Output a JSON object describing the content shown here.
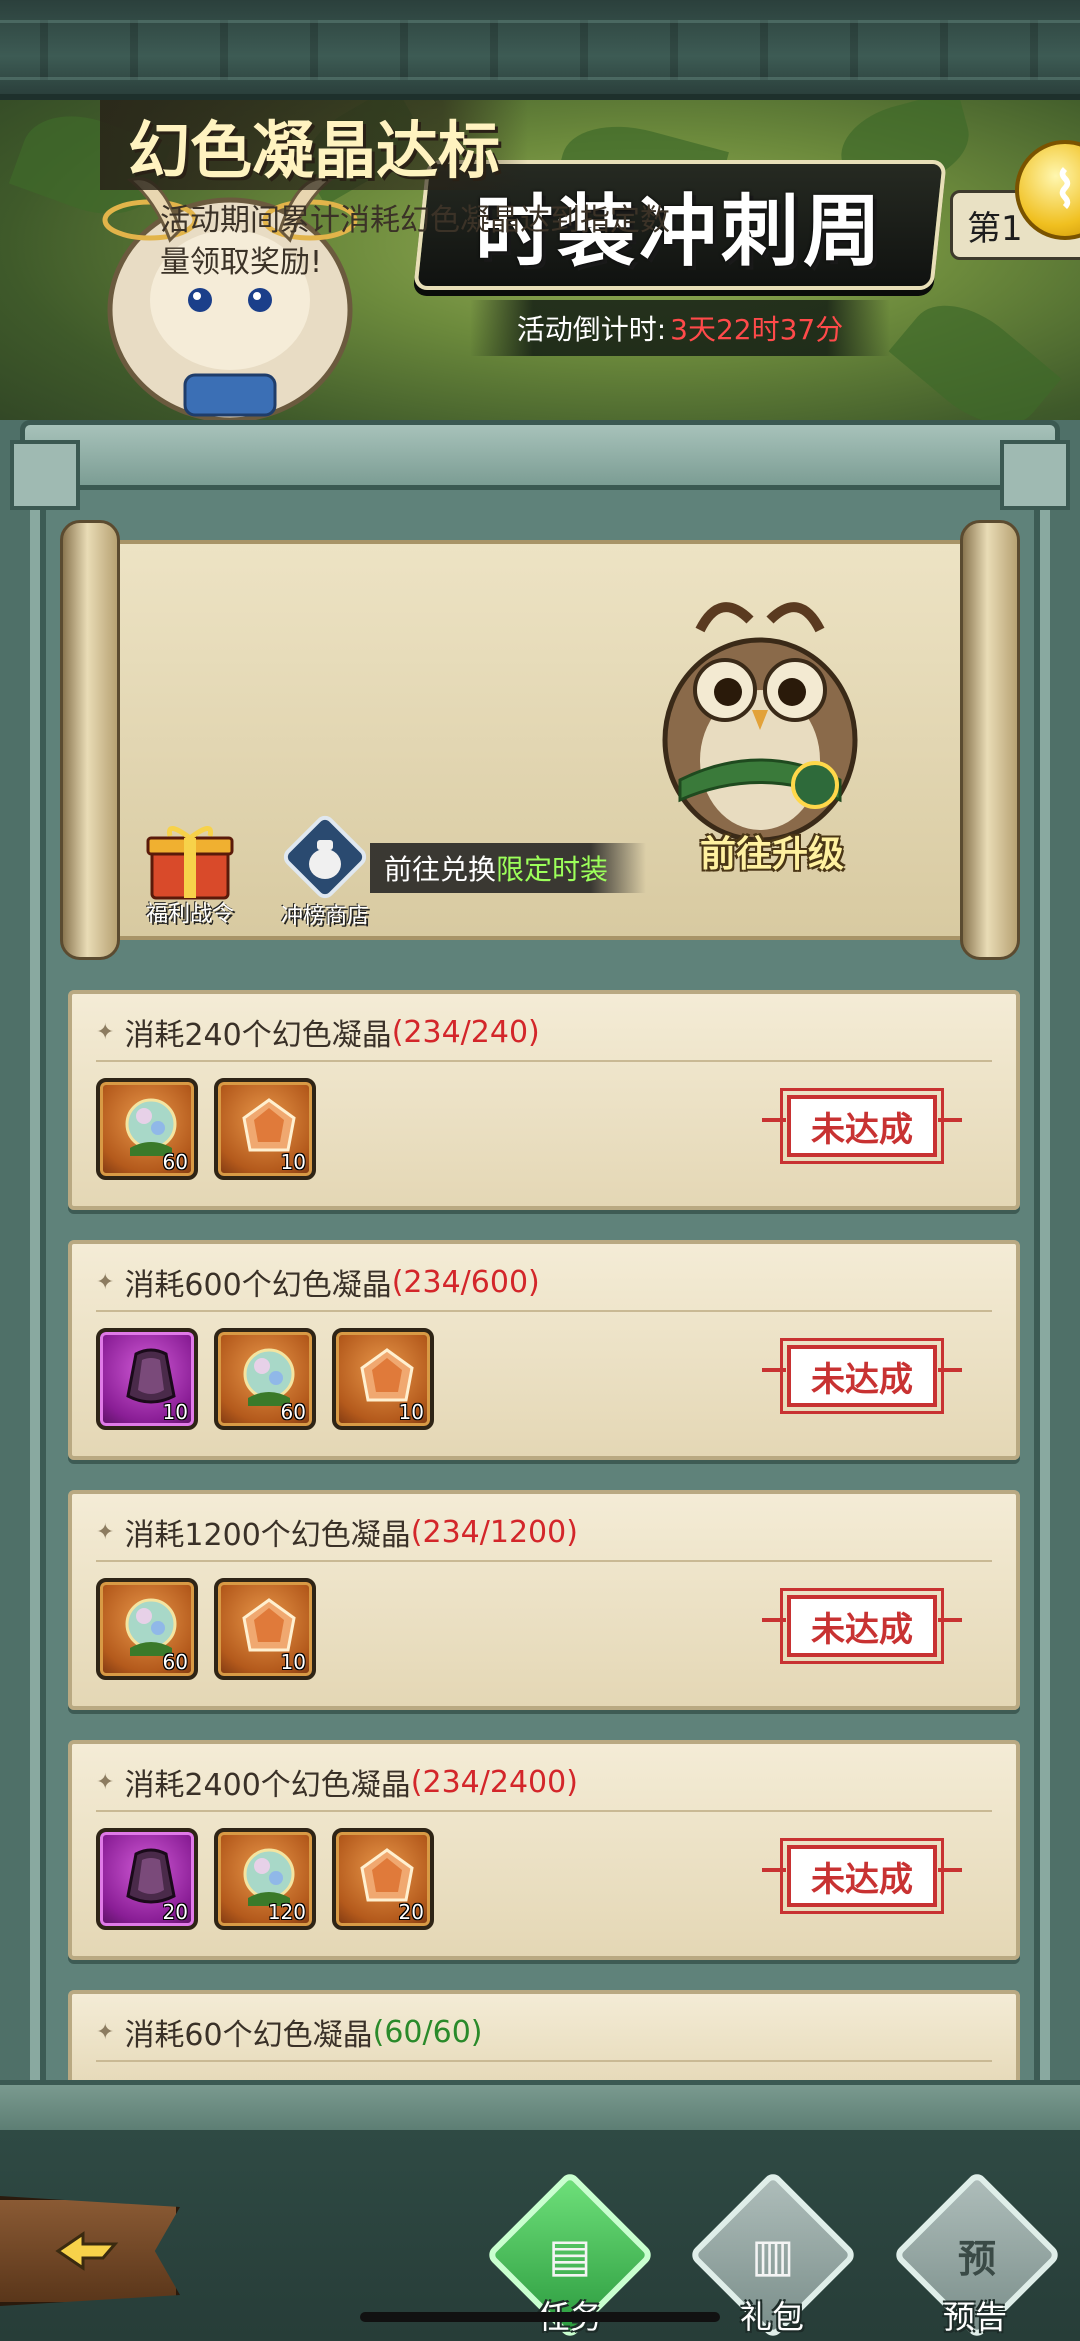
{
  "header": {
    "title": "时装冲刺周",
    "week_tab": "第1",
    "countdown_label": "活动倒计时:",
    "countdown_value": "3天22时37分"
  },
  "event": {
    "title": "幻色凝晶达标",
    "description": "活动期间累计消耗幻色凝晶达到指定数量领取奖励!",
    "upgrade_label": "前往升级",
    "gift_label": "福利战令",
    "shop_label": "冲榜商店",
    "exchange_prefix": "前往兑换",
    "exchange_highlight": "限定时装"
  },
  "tasks": [
    {
      "title": "消耗240个幻色凝晶",
      "progress": "(234/240)",
      "progress_color": "red",
      "rewards": [
        {
          "type": "crystal-orb",
          "frame": "orange",
          "count": "60"
        },
        {
          "type": "amber-gem",
          "frame": "orange",
          "count": "10"
        }
      ],
      "status": "未达成"
    },
    {
      "title": "消耗600个幻色凝晶",
      "progress": "(234/600)",
      "progress_color": "red",
      "rewards": [
        {
          "type": "purple-cloak",
          "frame": "purple",
          "count": "10"
        },
        {
          "type": "crystal-orb",
          "frame": "orange",
          "count": "60"
        },
        {
          "type": "amber-gem",
          "frame": "orange",
          "count": "10"
        }
      ],
      "status": "未达成"
    },
    {
      "title": "消耗1200个幻色凝晶",
      "progress": "(234/1200)",
      "progress_color": "red",
      "rewards": [
        {
          "type": "crystal-orb",
          "frame": "orange",
          "count": "60"
        },
        {
          "type": "amber-gem",
          "frame": "orange",
          "count": "10"
        }
      ],
      "status": "未达成"
    },
    {
      "title": "消耗2400个幻色凝晶",
      "progress": "(234/2400)",
      "progress_color": "red",
      "rewards": [
        {
          "type": "purple-cloak",
          "frame": "purple",
          "count": "20"
        },
        {
          "type": "crystal-orb",
          "frame": "orange",
          "count": "120"
        },
        {
          "type": "amber-gem",
          "frame": "orange",
          "count": "20"
        }
      ],
      "status": "未达成"
    },
    {
      "title": "消耗60个幻色凝晶",
      "progress": "(60/60)",
      "progress_color": "green",
      "rewards": [],
      "status": ""
    }
  ],
  "nav": {
    "tasks_label": "任务",
    "gifts_label": "礼包",
    "preview_label": "预告",
    "preview_glyph": "预"
  },
  "colors": {
    "progress_red": "#d3262a",
    "progress_green": "#2a8a2a",
    "stamp_red": "#c83232",
    "highlight_green": "#9cff5a"
  }
}
